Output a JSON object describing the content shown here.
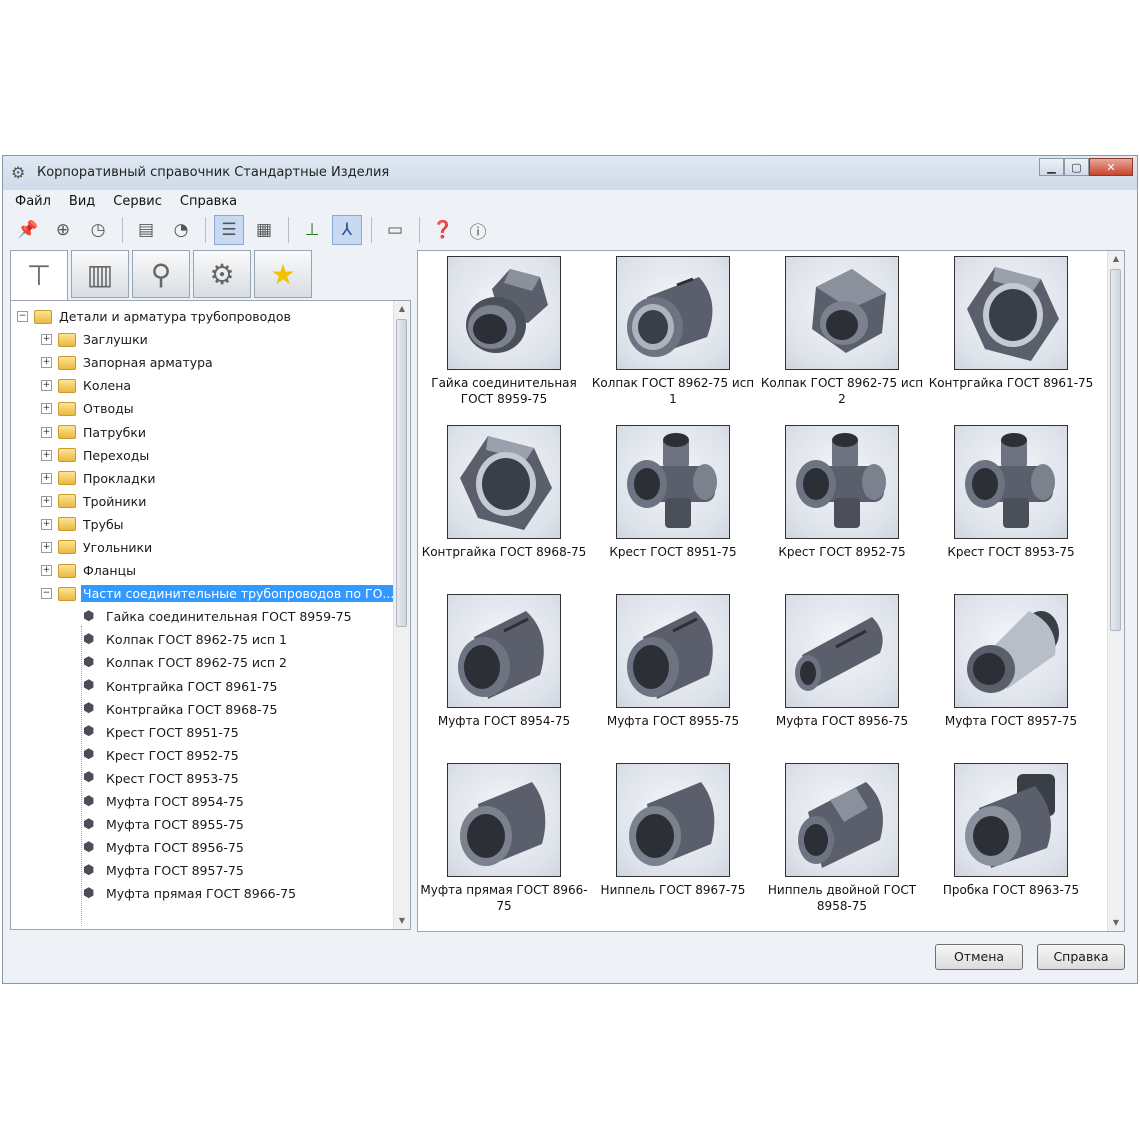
{
  "window": {
    "title": "Корпоративный справочник Стандартные Изделия"
  },
  "menu": [
    "Файл",
    "Вид",
    "Сервис",
    "Справка"
  ],
  "toolbar": [
    "pin-icon",
    "binoculars-icon",
    "clock-icon",
    "save-icon",
    "refresh-icon",
    "list-view-icon",
    "table-view-icon",
    "axis-2d-icon",
    "axis-3d-icon",
    "panel-icon",
    "help-icon",
    "info-icon"
  ],
  "tabs": [
    "bolt-tab",
    "drawing-tab",
    "fitting-tab",
    "gear-tab",
    "favorites-tab"
  ],
  "tree": {
    "root": "Детали и арматура трубопроводов",
    "folders": [
      "Заглушки",
      "Запорная арматура",
      "Колена",
      "Отводы",
      "Патрубки",
      "Переходы",
      "Прокладки",
      "Тройники",
      "Трубы",
      "Угольники",
      "Фланцы",
      "Части соединительные трубопроводов по ГО..."
    ],
    "selected": "Части соединительные трубопроводов по ГО...",
    "items": [
      "Гайка соединительная ГОСТ 8959-75",
      "Колпак ГОСТ 8962-75 исп 1",
      "Колпак ГОСТ 8962-75 исп 2",
      "Контргайка ГОСТ 8961-75",
      "Контргайка ГОСТ 8968-75",
      "Крест ГОСТ 8951-75",
      "Крест ГОСТ 8952-75",
      "Крест ГОСТ 8953-75",
      "Муфта ГОСТ 8954-75",
      "Муфта ГОСТ 8955-75",
      "Муфта ГОСТ 8956-75",
      "Муфта ГОСТ 8957-75",
      "Муфта прямая ГОСТ 8966-75"
    ]
  },
  "gallery": [
    {
      "label": "Гайка соединительная ГОСТ 8959-75",
      "shape": "nut-coupling"
    },
    {
      "label": "Колпак ГОСТ 8962-75 исп 1",
      "shape": "cap"
    },
    {
      "label": "Колпак ГОСТ 8962-75 исп 2",
      "shape": "hex-cap"
    },
    {
      "label": "Контргайка ГОСТ 8961-75",
      "shape": "locknut"
    },
    {
      "label": "Контргайка ГОСТ 8968-75",
      "shape": "locknut"
    },
    {
      "label": "Крест ГОСТ 8951-75",
      "shape": "cross"
    },
    {
      "label": "Крест ГОСТ 8952-75",
      "shape": "cross"
    },
    {
      "label": "Крест ГОСТ 8953-75",
      "shape": "cross"
    },
    {
      "label": "Муфта ГОСТ 8954-75",
      "shape": "coupling"
    },
    {
      "label": "Муфта ГОСТ 8955-75",
      "shape": "coupling"
    },
    {
      "label": "Муфта ГОСТ 8956-75",
      "shape": "long-coupling"
    },
    {
      "label": "Муфта ГОСТ 8957-75",
      "shape": "reducer"
    },
    {
      "label": "Муфта прямая ГОСТ 8966-75",
      "shape": "sleeve"
    },
    {
      "label": "Ниппель ГОСТ 8967-75",
      "shape": "sleeve"
    },
    {
      "label": "Ниппель двойной ГОСТ 8958-75",
      "shape": "double-nipple"
    },
    {
      "label": "Пробка ГОСТ 8963-75",
      "shape": "plug"
    }
  ],
  "buttons": {
    "cancel": "Отмена",
    "help": "Справка"
  }
}
